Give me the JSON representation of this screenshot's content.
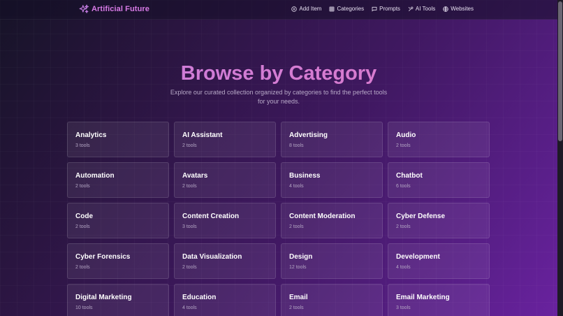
{
  "brand": {
    "name": "Artificial Future",
    "accent": "#d77ae6",
    "icon": "sparkles-icon"
  },
  "nav": [
    {
      "label": "Add Item",
      "icon": "plus-circle-icon"
    },
    {
      "label": "Categories",
      "icon": "grid-icon"
    },
    {
      "label": "Prompts",
      "icon": "chat-bubble-icon"
    },
    {
      "label": "AI Tools",
      "icon": "tools-icon"
    },
    {
      "label": "Websites",
      "icon": "globe-icon"
    }
  ],
  "hero": {
    "title": "Browse by Category",
    "subtitle": "Explore our curated collection organized by categories to find the perfect tools for your needs."
  },
  "categories": [
    {
      "name": "Analytics",
      "count": "3 tools"
    },
    {
      "name": "AI Assistant",
      "count": "2 tools"
    },
    {
      "name": "Advertising",
      "count": "8 tools"
    },
    {
      "name": "Audio",
      "count": "2 tools"
    },
    {
      "name": "Automation",
      "count": "2 tools"
    },
    {
      "name": "Avatars",
      "count": "2 tools"
    },
    {
      "name": "Business",
      "count": "4 tools"
    },
    {
      "name": "Chatbot",
      "count": "6 tools"
    },
    {
      "name": "Code",
      "count": "2 tools"
    },
    {
      "name": "Content Creation",
      "count": "3 tools"
    },
    {
      "name": "Content Moderation",
      "count": "2 tools"
    },
    {
      "name": "Cyber Defense",
      "count": "2 tools"
    },
    {
      "name": "Cyber Forensics",
      "count": "2 tools"
    },
    {
      "name": "Data Visualization",
      "count": "2 tools"
    },
    {
      "name": "Design",
      "count": "12 tools"
    },
    {
      "name": "Development",
      "count": "4 tools"
    },
    {
      "name": "Digital Marketing",
      "count": "10 tools"
    },
    {
      "name": "Education",
      "count": "4 tools"
    },
    {
      "name": "Email",
      "count": "2 tools"
    },
    {
      "name": "Email Marketing",
      "count": "3 tools"
    }
  ]
}
